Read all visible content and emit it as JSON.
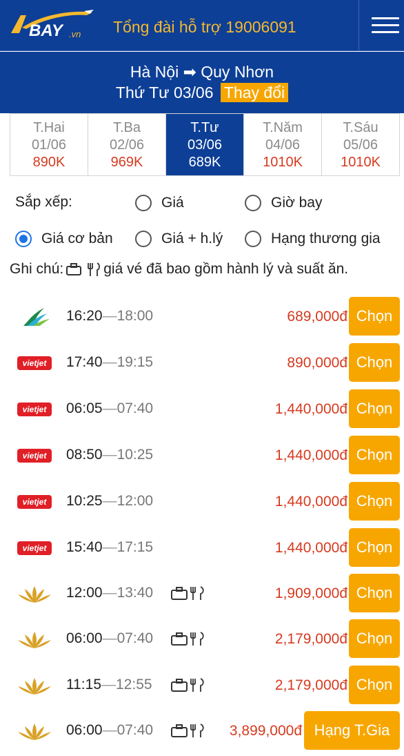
{
  "header": {
    "logo_text": "BAY.vn",
    "hotline": "Tổng đài hỗ trợ 19006091"
  },
  "route": {
    "from": "Hà Nội",
    "to": "Quy Nhơn",
    "arrow": "➡",
    "date": "Thứ Tư 03/06",
    "change_label": "Thay đổi"
  },
  "days": [
    {
      "name": "T.Hai",
      "date": "01/06",
      "price": "890K",
      "active": false
    },
    {
      "name": "T.Ba",
      "date": "02/06",
      "price": "969K",
      "active": false
    },
    {
      "name": "T.Tư",
      "date": "03/06",
      "price": "689K",
      "active": true
    },
    {
      "name": "T.Năm",
      "date": "04/06",
      "price": "1010K",
      "active": false
    },
    {
      "name": "T.Sáu",
      "date": "05/06",
      "price": "1010K",
      "active": false
    }
  ],
  "sort": {
    "label": "Sắp xếp:",
    "options": [
      "Giá",
      "Giờ bay",
      "Giá cơ bản",
      "Giá + h.lý",
      "Hạng thương gia"
    ],
    "selected": "Giá cơ bản"
  },
  "note": {
    "prefix": "Ghi chú:",
    "text": "giá vé đã bao gồm hành lý và suất ăn."
  },
  "flights": [
    {
      "airline": "bamboo",
      "depart": "16:20",
      "arrive": "18:00",
      "extras": false,
      "price": "689,000đ",
      "action": "Chọn"
    },
    {
      "airline": "vietjet",
      "depart": "17:40",
      "arrive": "19:15",
      "extras": false,
      "price": "890,000đ",
      "action": "Chọn"
    },
    {
      "airline": "vietjet",
      "depart": "06:05",
      "arrive": "07:40",
      "extras": false,
      "price": "1,440,000đ",
      "action": "Chọn"
    },
    {
      "airline": "vietjet",
      "depart": "08:50",
      "arrive": "10:25",
      "extras": false,
      "price": "1,440,000đ",
      "action": "Chọn"
    },
    {
      "airline": "vietjet",
      "depart": "10:25",
      "arrive": "12:00",
      "extras": false,
      "price": "1,440,000đ",
      "action": "Chọn"
    },
    {
      "airline": "vietjet",
      "depart": "15:40",
      "arrive": "17:15",
      "extras": false,
      "price": "1,440,000đ",
      "action": "Chọn"
    },
    {
      "airline": "vietnam-airlines",
      "depart": "12:00",
      "arrive": "13:40",
      "extras": true,
      "price": "1,909,000đ",
      "action": "Chọn"
    },
    {
      "airline": "vietnam-airlines",
      "depart": "06:00",
      "arrive": "07:40",
      "extras": true,
      "price": "2,179,000đ",
      "action": "Chọn"
    },
    {
      "airline": "vietnam-airlines",
      "depart": "11:15",
      "arrive": "12:55",
      "extras": true,
      "price": "2,179,000đ",
      "action": "Chọn"
    },
    {
      "airline": "vietnam-airlines",
      "depart": "06:00",
      "arrive": "07:40",
      "extras": true,
      "price": "3,899,000đ",
      "action": "Hạng T.Gia"
    }
  ],
  "vietjet_text": "vietjet",
  "colors": {
    "header_bg": "#0d3f96",
    "accent": "#f7a600",
    "price_red": "#d63a1f",
    "radio_blue": "#1e73e6"
  }
}
